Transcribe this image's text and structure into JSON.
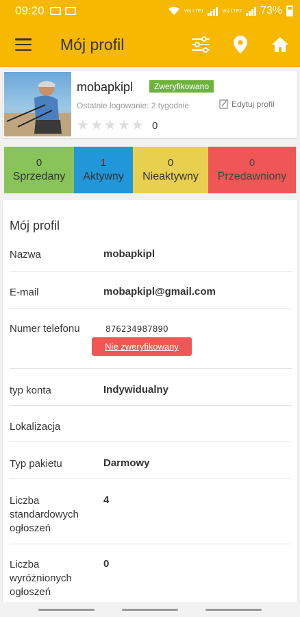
{
  "status_bar": {
    "time": "09:20",
    "network_1": "Vo) LTE1",
    "network_2": "Vo) LTE2",
    "battery": "73%"
  },
  "app_bar": {
    "title": "Mój profil",
    "icons": [
      "menu-icon",
      "filter-sliders-icon",
      "location-pin-icon",
      "home-icon"
    ]
  },
  "profile": {
    "username": "mobapkipl",
    "verified_badge": "Zweryfikowano",
    "last_login": "Ostatnie logowanie: 2 tygodnie",
    "edit_label": "Edytuj profil",
    "rating_stars": 0,
    "rating": "0"
  },
  "stats": [
    {
      "count": "0",
      "label": "Sprzedany",
      "color": "#88c45a"
    },
    {
      "count": "1",
      "label": "Aktywny",
      "color": "#2196d9"
    },
    {
      "count": "0",
      "label": "Nieaktywny",
      "color": "#e8cf4e"
    },
    {
      "count": "0",
      "label": "Przedawniony",
      "color": "#ef5656"
    }
  ],
  "details": {
    "heading": "Mój profil",
    "rows": [
      {
        "label": "Nazwa",
        "value": "mobapkipl"
      },
      {
        "label": "E-mail",
        "value": "mobapkipl@gmail.com"
      },
      {
        "label": "Numer telefonu",
        "value": "876234987890",
        "action": "Nie zweryfikowany"
      },
      {
        "label": "typ konta",
        "value": "Indywidualny"
      },
      {
        "label": "Lokalizacja",
        "value": ""
      },
      {
        "label": "Typ pakietu",
        "value": "Darmowy"
      },
      {
        "label": "Liczba standardowych ogłoszeń",
        "value": "4"
      },
      {
        "label": "Liczba wyróżnionych ogłoszeń",
        "value": "0"
      }
    ]
  },
  "colors": {
    "accent": "#f6b800",
    "verified": "#6fb33d",
    "alert": "#ef5656"
  }
}
